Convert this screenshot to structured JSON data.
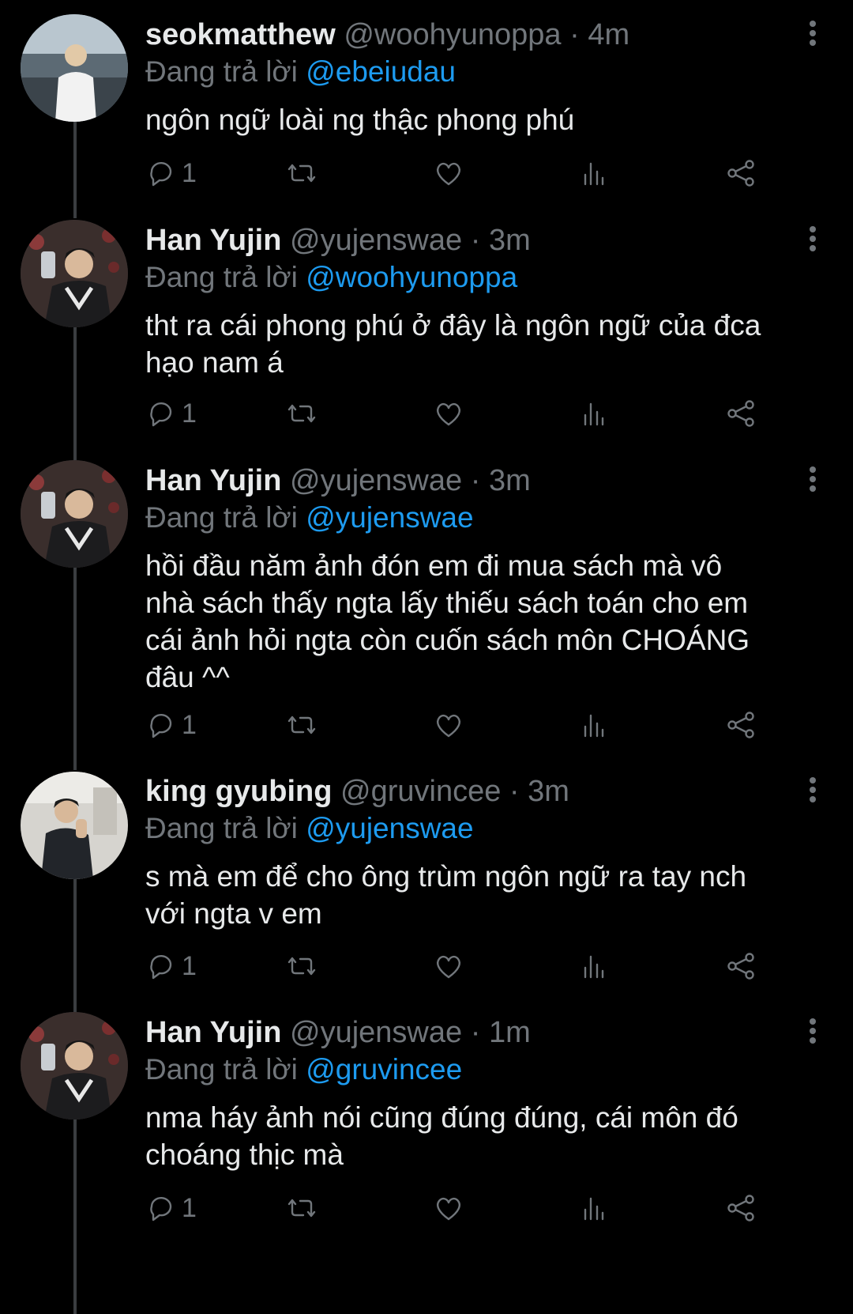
{
  "tweets": [
    {
      "name": "seokmatthew",
      "handle": "@woohyunoppa",
      "dot": "·",
      "time": "4m",
      "replying_prefix": "Đang trả lời",
      "replying_to": "@ebeiudau",
      "text": "ngôn ngữ loài ng thậc phong phú",
      "reply_count": "1"
    },
    {
      "name": "Han Yujin",
      "handle": "@yujenswae",
      "dot": "·",
      "time": "3m",
      "replying_prefix": "Đang trả lời",
      "replying_to": "@woohyunoppa",
      "text": "tht ra cái phong phú ở đây là ngôn ngữ của đca\nhạo nam á",
      "reply_count": "1"
    },
    {
      "name": "Han Yujin",
      "handle": "@yujenswae",
      "dot": "·",
      "time": "3m",
      "replying_prefix": "Đang trả lời",
      "replying_to": "@yujenswae",
      "text": "hồi đầu năm ảnh đón em đi mua sách mà vô\nnhà sách thấy ngta lấy thiếu sách toán cho em\ncái ảnh hỏi ngta còn cuốn sách môn CHOÁNG\nđâu ^^",
      "reply_count": "1"
    },
    {
      "name": "king gyubing",
      "handle": "@gruvincee",
      "dot": "·",
      "time": "3m",
      "replying_prefix": "Đang trả lời",
      "replying_to": "@yujenswae",
      "text": "s mà em để cho ông trùm ngôn ngữ ra tay nch\nvới ngta v em",
      "reply_count": "1"
    },
    {
      "name": "Han Yujin",
      "handle": "@yujenswae",
      "dot": "·",
      "time": "1m",
      "replying_prefix": "Đang trả lời",
      "replying_to": "@gruvincee",
      "text": "nma háy ảnh nói cũng đúng đúng, cái môn đó\nchoáng thịc mà",
      "reply_count": "1"
    }
  ],
  "icons": {
    "reply": "reply-icon",
    "retweet": "retweet-icon",
    "like": "like-icon",
    "views": "views-icon",
    "share": "share-icon",
    "more": "more-icon"
  }
}
